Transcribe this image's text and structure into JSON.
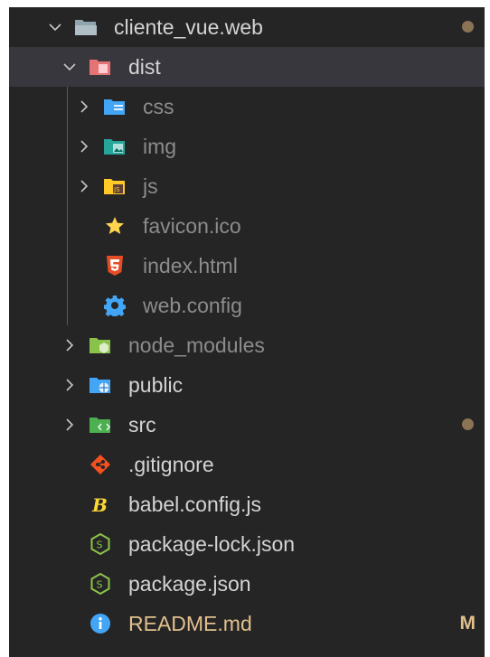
{
  "explorer": {
    "root": {
      "label": "cliente_vue.web",
      "modified": true
    },
    "dist": {
      "label": "dist"
    },
    "dist_children": {
      "css": "css",
      "img": "img",
      "js": "js",
      "favicon": "favicon.ico",
      "index": "index.html",
      "webconfig": "web.config"
    },
    "node_modules": "node_modules",
    "public": "public",
    "src": {
      "label": "src",
      "modified": true
    },
    "gitignore": ".gitignore",
    "babel": "babel.config.js",
    "package_lock": "package-lock.json",
    "package": "package.json",
    "readme": {
      "label": "README.md",
      "badge": "M"
    }
  },
  "colors": {
    "background": "#252526",
    "selected_row": "#37373d",
    "modified_dot": "#8b7355",
    "modified_badge": "#e2c08d",
    "folder_blue": "#90a4ae",
    "css_blue": "#42a5f5",
    "img_teal": "#26a69a",
    "js_yellow": "#ffca28",
    "star_yellow": "#ffd54f",
    "html_orange": "#e44d26",
    "gear_blue": "#42a5f5",
    "node_green": "#8bc34a",
    "src_green": "#4caf50",
    "git_orange": "#f4511e",
    "info_blue": "#42a5f5"
  }
}
